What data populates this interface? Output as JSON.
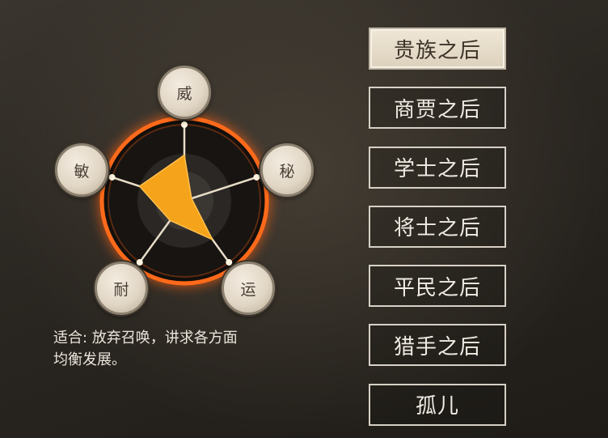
{
  "radar": {
    "stats": [
      {
        "key": "wei",
        "label": "威",
        "value": 0.6
      },
      {
        "key": "mi",
        "label": "秘",
        "value": 0.1
      },
      {
        "key": "yun",
        "label": "运",
        "value": 0.63
      },
      {
        "key": "nai",
        "label": "耐",
        "value": 0.32
      },
      {
        "key": "min",
        "label": "敏",
        "value": 0.62
      }
    ],
    "colors": {
      "fill": "#f5a31a",
      "ring": "#ff6a1a"
    }
  },
  "description": {
    "line1": "适合: 放弃召唤，讲求各方面",
    "line2": "均衡发展。"
  },
  "origins": [
    {
      "label": "贵族之后",
      "selected": true
    },
    {
      "label": "商贾之后",
      "selected": false
    },
    {
      "label": "学士之后",
      "selected": false
    },
    {
      "label": "将士之后",
      "selected": false
    },
    {
      "label": "平民之后",
      "selected": false
    },
    {
      "label": "猎手之后",
      "selected": false
    },
    {
      "label": "孤儿",
      "selected": false
    }
  ]
}
